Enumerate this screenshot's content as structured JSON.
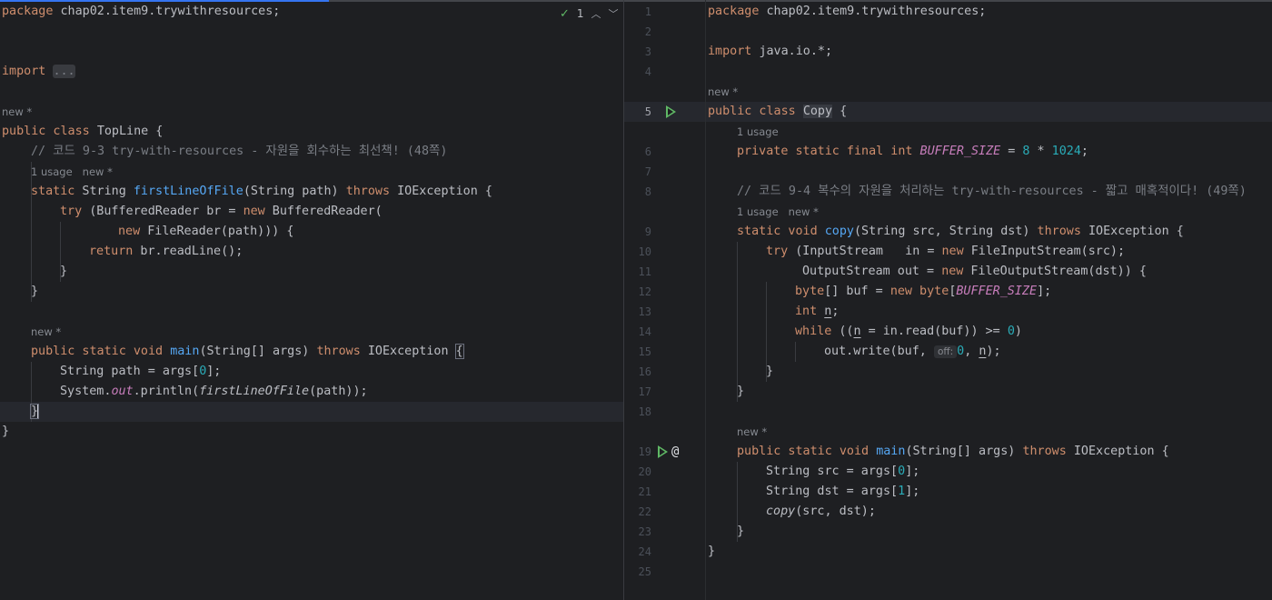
{
  "inspections": {
    "count": "1"
  },
  "left_editor": {
    "package_line": "chap02.item9.trywithresources;",
    "import_fold": "...",
    "hint_new": "new *",
    "hint_usage": "1 usage",
    "class_name": "TopLine",
    "comment": "// 코드 9-3 try-with-resources - 자원을 회수하는 최선책! (48쪽)",
    "method_first": "firstLineOfFile",
    "method_main": "main"
  },
  "right_editor": {
    "line_numbers": [
      "1",
      "2",
      "3",
      "4",
      "5",
      "6",
      "7",
      "8",
      "9",
      "10",
      "11",
      "12",
      "13",
      "14",
      "15",
      "16",
      "17",
      "18",
      "19",
      "20",
      "21",
      "22",
      "23",
      "24",
      "25"
    ],
    "package_line": "chap02.item9.trywithresources;",
    "import_line": "java.io.*;",
    "hint_new": "new *",
    "hint_usage": "1 usage",
    "class_name": "Copy",
    "buffer_const": "BUFFER_SIZE",
    "comment": "// 코드 9-4 복수의 자원을 처리하는 try-with-resources - 짧고 매혹적이다! (49쪽)",
    "inlay_off": "off:"
  }
}
